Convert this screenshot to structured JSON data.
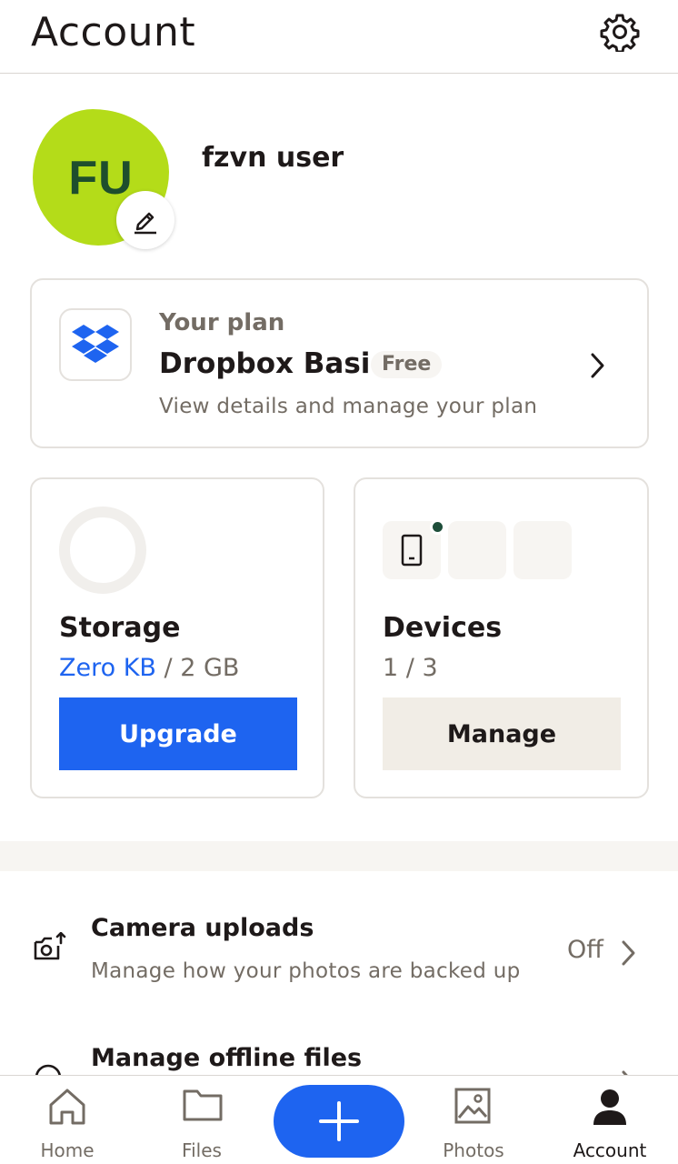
{
  "header": {
    "title": "Account",
    "settings_icon": "gear-icon"
  },
  "profile": {
    "initials": "FU",
    "name": "fzvn user",
    "avatar_color": "#b4dc19",
    "edit_icon": "pencil-icon"
  },
  "plan": {
    "label": "Your plan",
    "name": "Dropbox Basic",
    "badge": "Free",
    "description": "View details and manage your plan",
    "icon": "dropbox-logo-icon"
  },
  "storage": {
    "title": "Storage",
    "used": "Zero KB",
    "separator": " / ",
    "total": "2 GB",
    "button": "Upgrade",
    "used_fraction": 0
  },
  "devices": {
    "title": "Devices",
    "count": "1 / 3",
    "button": "Manage",
    "connected": 1,
    "max": 3
  },
  "list": {
    "camera_uploads": {
      "title": "Camera uploads",
      "description": "Manage how your photos are backed up",
      "status": "Off",
      "icon": "camera-upload-icon"
    },
    "offline_files": {
      "title": "Manage offline files",
      "icon": "offline-icon"
    }
  },
  "tabbar": {
    "home": "Home",
    "files": "Files",
    "photos": "Photos",
    "account": "Account",
    "active": "account",
    "fab_icon": "plus-icon"
  },
  "colors": {
    "accent": "#1e64f0",
    "text": "#1e1919",
    "muted": "#736c64",
    "beige": "#f1ede6"
  }
}
